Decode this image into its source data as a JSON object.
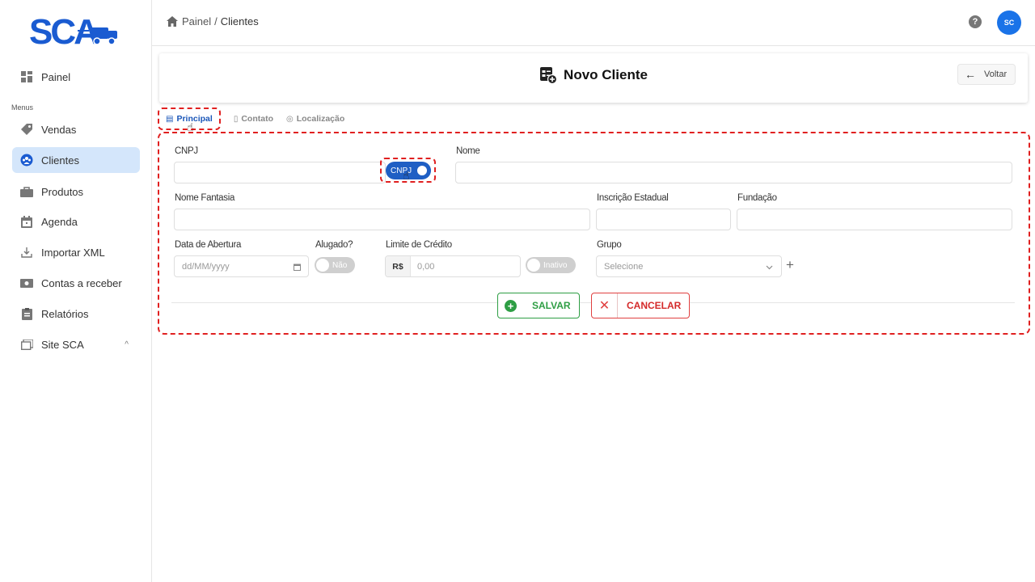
{
  "brand": {
    "logo_text": "SCA"
  },
  "sidebar": {
    "section_label": "Menus",
    "items": [
      {
        "label": "Painel",
        "icon": "dashboard-icon"
      },
      {
        "label": "Vendas",
        "icon": "tag-icon"
      },
      {
        "label": "Clientes",
        "icon": "clients-icon",
        "active": true
      },
      {
        "label": "Produtos",
        "icon": "bag-icon"
      },
      {
        "label": "Agenda",
        "icon": "calendar-icon"
      },
      {
        "label": "Importar XML",
        "icon": "download-icon"
      },
      {
        "label": "Contas a receber",
        "icon": "money-icon"
      },
      {
        "label": "Relatórios",
        "icon": "clipboard-icon"
      },
      {
        "label": "Site SCA",
        "icon": "window-icon",
        "expand": "^"
      }
    ]
  },
  "topbar": {
    "breadcrumb": {
      "home": "Painel",
      "separator": "/",
      "current": "Clientes"
    },
    "help": "?",
    "avatar": "SC"
  },
  "header": {
    "title": "Novo Cliente",
    "back_label": "Voltar"
  },
  "tabs": [
    {
      "label": "Principal",
      "active": true
    },
    {
      "label": "Contato"
    },
    {
      "label": "Localização"
    }
  ],
  "form": {
    "cnpj": {
      "label": "CNPJ",
      "value": "",
      "toggle_label": "CNPJ"
    },
    "nome": {
      "label": "Nome",
      "value": ""
    },
    "nome_fantasia": {
      "label": "Nome Fantasia",
      "value": ""
    },
    "inscricao": {
      "label": "Inscrição Estadual",
      "value": ""
    },
    "fundacao": {
      "label": "Fundação",
      "value": ""
    },
    "data_abertura": {
      "label": "Data de Abertura",
      "placeholder": "dd/MM/yyyy"
    },
    "alugado": {
      "label": "Alugado?",
      "toggle_label": "Não"
    },
    "limite": {
      "label": "Limite de Crédito",
      "prefix": "R$",
      "placeholder": "0,00",
      "toggle_label": "Inativo"
    },
    "grupo": {
      "label": "Grupo",
      "placeholder": "Selecione",
      "add": "+"
    }
  },
  "actions": {
    "save_label": "SALVAR",
    "cancel_label": "CANCELAR"
  },
  "colors": {
    "accent": "#1a73e8",
    "active_bg": "#d4e6fb",
    "save": "#2e9e44",
    "cancel": "#d42a2a",
    "highlight": "#e02020"
  }
}
